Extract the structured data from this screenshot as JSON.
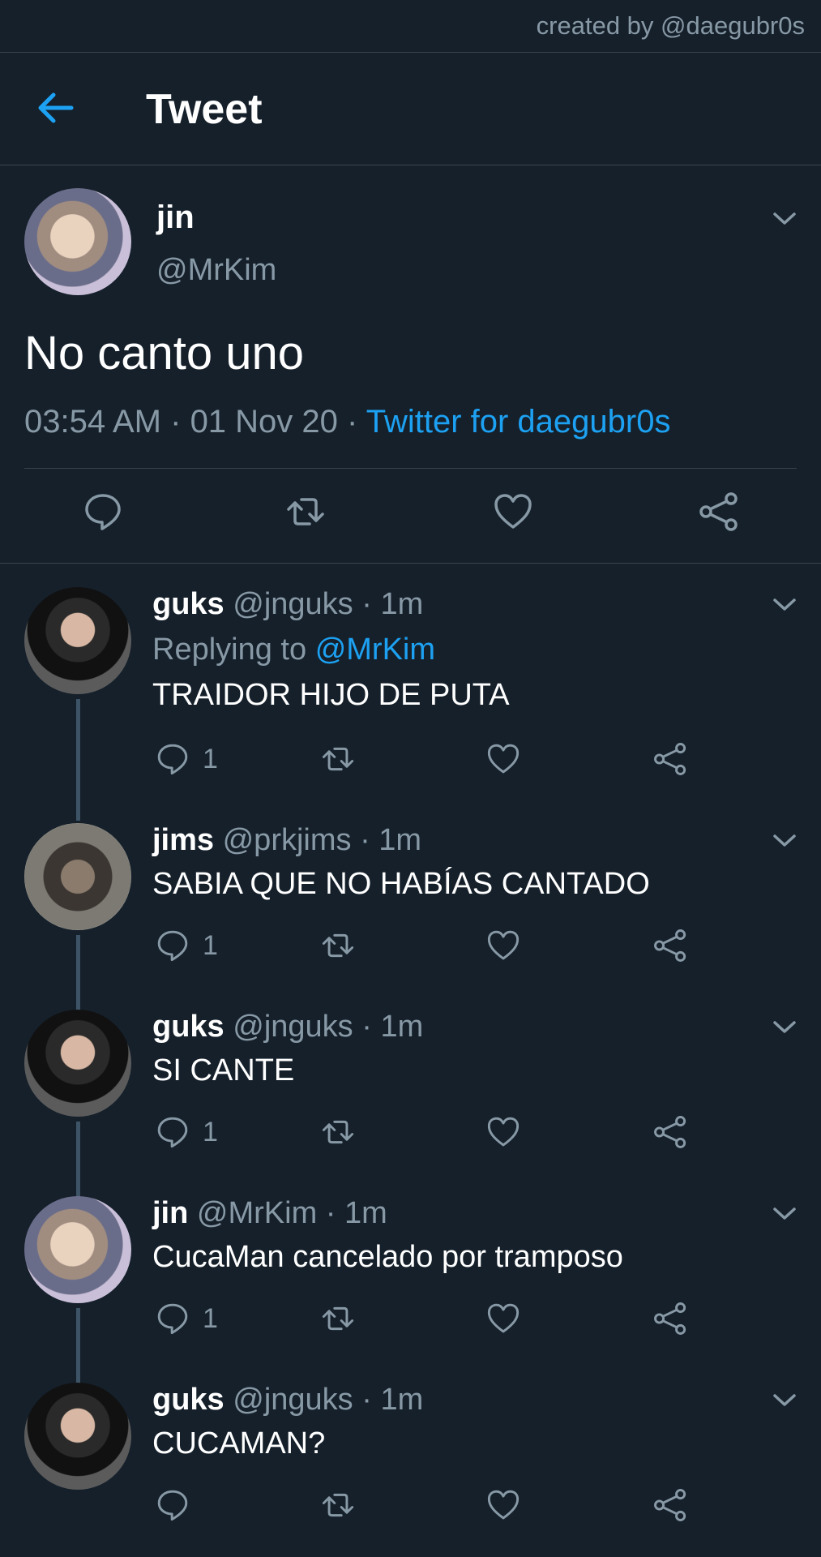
{
  "credit": "created by @daegubr0s",
  "header": {
    "title": "Tweet"
  },
  "main_tweet": {
    "name": "jin",
    "handle": "@MrKim",
    "text": "No canto uno",
    "time": "03:54 AM",
    "date": "01 Nov 20",
    "source": "Twitter for daegubr0s"
  },
  "replies": [
    {
      "name": "guks",
      "handle": "@jnguks",
      "time": "1m",
      "replying_label": "Replying to",
      "replying_to": "@MrKim",
      "text": "TRAIDOR HIJO DE PUTA",
      "reply_count": "1"
    },
    {
      "name": "jims",
      "handle": "@prkjims",
      "time": "1m",
      "text": "SABIA QUE NO HABÍAS CANTADO",
      "reply_count": "1"
    },
    {
      "name": "guks",
      "handle": "@jnguks",
      "time": "1m",
      "text": "SI CANTE",
      "reply_count": "1"
    },
    {
      "name": "jin",
      "handle": "@MrKim",
      "time": "1m",
      "text": "CucaMan cancelado por tramposo",
      "reply_count": "1"
    },
    {
      "name": "guks",
      "handle": "@jnguks",
      "time": "1m",
      "text": "CUCAMAN?",
      "reply_count": ""
    }
  ],
  "colors": {
    "background": "#15202b",
    "accent": "#1da1f2",
    "muted": "#8899a6",
    "divider": "#38444d"
  }
}
